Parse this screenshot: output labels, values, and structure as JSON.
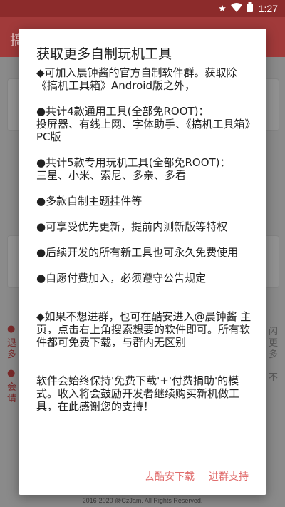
{
  "status_bar": {
    "time": "1:27",
    "icons": [
      "star-icon",
      "wifi-icon",
      "battery-icon"
    ]
  },
  "background": {
    "appbar_title": "搞",
    "red_lines": [
      "●",
      "退",
      "多",
      "●",
      "会",
      "请"
    ],
    "right_lines": [
      "闪",
      "更",
      "多",
      "不"
    ],
    "footer": "2016-2020 @CzJam. All Rights Reserved."
  },
  "dialog": {
    "title": "获取更多自制玩机工具",
    "paragraphs": [
      "◆可加入晨钟酱的官方自制软件群。获取除《搞机工具箱》Android版之外，",
      "●共计4款通用工具(全部免ROOT)：\n投屏器、有线上网、字体助手、《搞机工具箱》PC版",
      "●共计5款专用玩机工具(全部免ROOT)：\n三星、小米、索尼、多亲、多看",
      "●多款自制主题挂件等",
      "●可享受优先更新，提前内测新版等特权",
      "●后续开发的所有新工具也可永久免费使用",
      "●自愿付费加入，必须遵守公告规定",
      "◆如果不想进群，也可在酷安进入@晨钟酱 主页，点击右上角搜索想要的软件即可。所有软件都可免费下载，与群内无区别",
      "软件会始终保持'免费下载'+'付费捐助'的模式。收入将会鼓励开发者继续购买新机做工具，在此感谢您的支持！"
    ],
    "buttons": {
      "coolapk": "去酷安下载",
      "join": "进群支持"
    }
  },
  "colors": {
    "accent": "#e06c6c",
    "status_bar": "#8c2b2b",
    "appbar": "#a13a3a"
  }
}
